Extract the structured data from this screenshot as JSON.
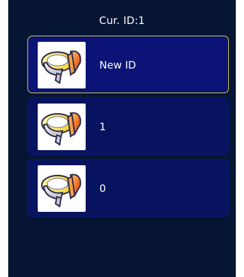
{
  "header": {
    "title": "Cur. ID:1"
  },
  "list": {
    "items": [
      {
        "label": "New ID",
        "icon": "ring-badge-icon",
        "selected": true
      },
      {
        "label": "1",
        "icon": "ring-badge-icon",
        "selected": false
      },
      {
        "label": "0",
        "icon": "ring-badge-icon",
        "selected": false
      }
    ]
  },
  "colors": {
    "background": "#061533",
    "item_background": "#08135f",
    "selected_border": "#d9cc4a",
    "text": "#ffffff"
  }
}
